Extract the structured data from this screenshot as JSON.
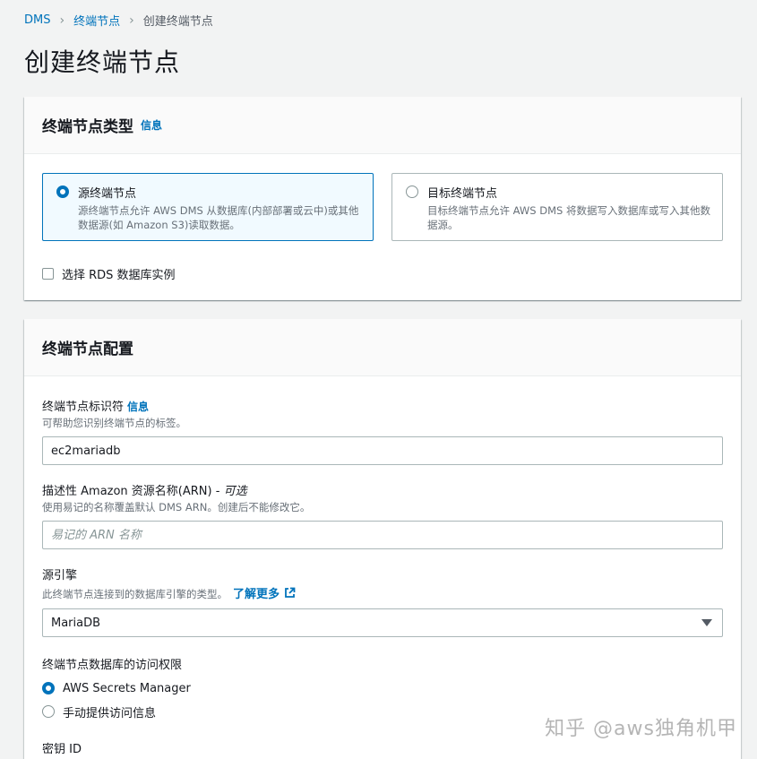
{
  "breadcrumb": {
    "items": [
      {
        "label": "DMS"
      },
      {
        "label": "终端节点"
      }
    ],
    "current": "创建终端节点"
  },
  "page_title": "创建终端节点",
  "endpoint_type_panel": {
    "title": "终端节点类型",
    "info": "信息",
    "source_tile": {
      "title": "源终端节点",
      "description": "源终端节点允许 AWS DMS 从数据库(内部部署或云中)或其他数据源(如 Amazon S3)读取数据。",
      "selected": true
    },
    "target_tile": {
      "title": "目标终端节点",
      "description": "目标终端节点允许 AWS DMS 将数据写入数据库或写入其他数据源。",
      "selected": false
    },
    "rds_checkbox_label": "选择 RDS 数据库实例"
  },
  "endpoint_config_panel": {
    "title": "终端节点配置",
    "identifier": {
      "label": "终端节点标识符",
      "info": "信息",
      "description": "可帮助您识别终端节点的标签。",
      "value": "ec2mariadb"
    },
    "arn": {
      "label": "描述性 Amazon 资源名称(ARN) - ",
      "optional": "可选",
      "description": "使用易记的名称覆盖默认 DMS ARN。创建后不能修改它。",
      "placeholder": "易记的 ARN 名称"
    },
    "engine": {
      "label": "源引擎",
      "description": "此终端节点连接到的数据库引擎的类型。",
      "learn_more": "了解更多",
      "value": "MariaDB"
    },
    "access": {
      "label": "终端节点数据库的访问权限",
      "options": [
        {
          "label": "AWS Secrets Manager",
          "selected": true
        },
        {
          "label": "手动提供访问信息",
          "selected": false
        }
      ]
    },
    "secret_id_label": "密钥 ID"
  },
  "watermark": "知乎 @aws独角机甲",
  "colors": {
    "link": "#0073bb",
    "selected_tile_bg": "#f1faff",
    "page_bg": "#f2f3f3"
  }
}
